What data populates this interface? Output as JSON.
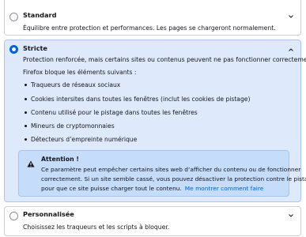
{
  "standard": {
    "title": "Standard",
    "description": "Équilibre entre protection et performances. Les pages se chargeront normalement."
  },
  "strict": {
    "title": "Stricte",
    "description": "Protection renforcée, mais certains sites ou contenus peuvent ne pas fonctionner correctement.",
    "blocks_intro": "Firefox bloque les éléments suivants :",
    "blocked_items": [
      "Traqueurs de réseaux sociaux",
      "Cookies intersites dans toutes les fenêtres (inclut les cookies de pistage)",
      "Contenu utilisé pour le pistage dans toutes les fenêtres",
      "Mineurs de cryptomonnaies",
      "Détecteurs d’empreinte numérique"
    ],
    "warning": {
      "title": "Attention !",
      "line1": "Ce paramètre peut empêcher certains sites web d’afficher du contenu ou de fonctionner",
      "line2": "correctement. Si un site semble cassé, vous pouvez désactiver la protection contre le pistage",
      "line3": "pour que ce site puisse charger tout le contenu.",
      "link": "Me montrer comment faire"
    }
  },
  "custom": {
    "title": "Personnalisée",
    "description": "Choisissez les traqueurs et les scripts à bloquer."
  },
  "colors": {
    "accent": "#0061e0",
    "selected_background": "#deeafc",
    "warning_background": "#c6dcfb"
  },
  "icons": {
    "expand": "chevron-down-icon",
    "warning": "warning-icon"
  }
}
